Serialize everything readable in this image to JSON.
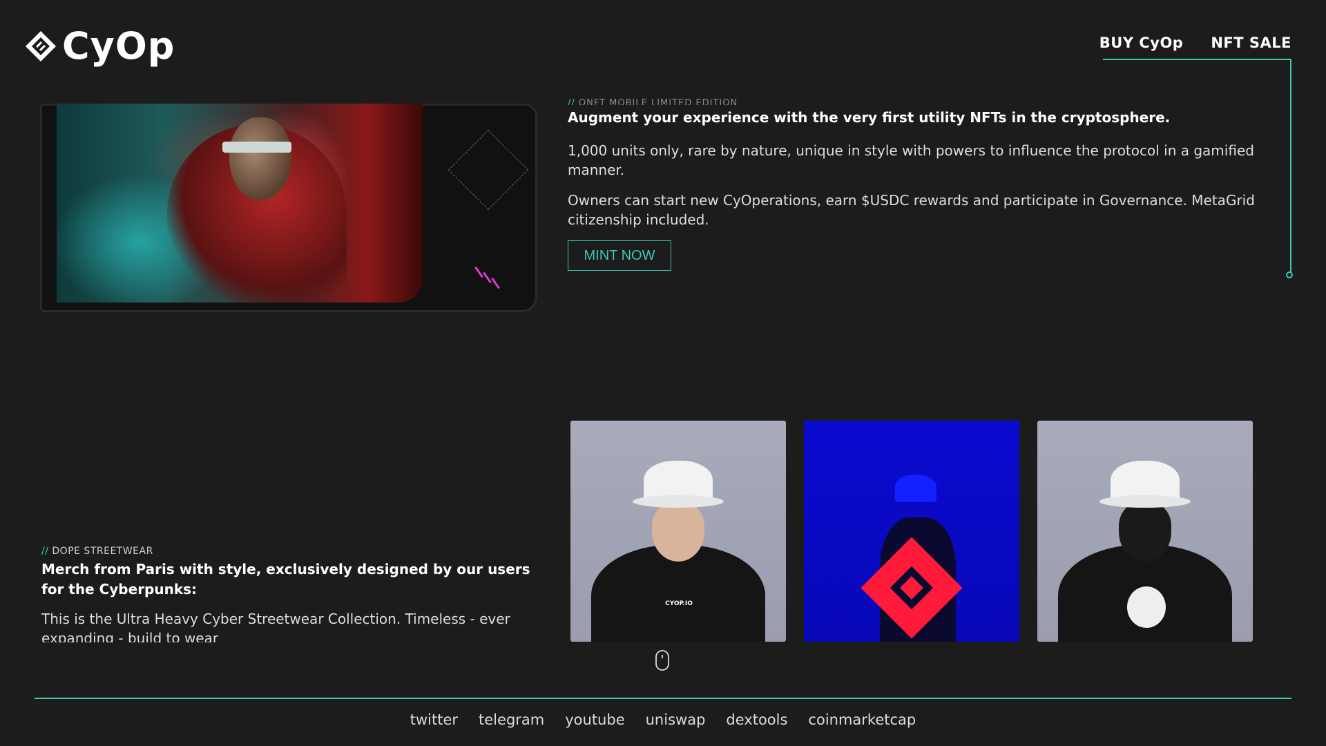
{
  "brand": {
    "name": "CyOp",
    "logo_icon": "cyop-diamond-logo"
  },
  "nav": {
    "items": [
      "BUY CyOp",
      "NFT SALE"
    ]
  },
  "colors": {
    "accent": "#3cc8b4",
    "background": "#1c1c1c",
    "text": "#ffffff"
  },
  "nft_section": {
    "tag": "ONFT MOBILE LIMITED EDITION",
    "headline": "Augment your experience with the very first utility NFTs in the cryptosphere.",
    "paragraph1": "1,000 units only, rare by nature, unique in style with powers to influence the protocol in a gamified manner.",
    "paragraph2": "Owners can start new CyOperations, earn $USDC rewards and participate in Governance. MetaGrid citizenship included.",
    "cta_label": "MINT NOW"
  },
  "street_section": {
    "tag": "DOPE STREETWEAR",
    "headline": "Merch from Paris with style, exclusively designed by our users for the Cyberpunks:",
    "paragraph": "This is the Ultra Heavy Cyber Streetwear Collection. Timeless - ever expanding - build to wear",
    "cards": [
      {
        "alt": "model front in white bucket hat and black CYOP.IO hoodie",
        "print": "CYOP.IO"
      },
      {
        "alt": "model in blue light with red CyOp logo"
      },
      {
        "alt": "model back view with printed hoodie"
      }
    ]
  },
  "scroll_indicator": {
    "icon": "mouse-scroll-icon"
  },
  "footer": {
    "links": [
      "twitter",
      "telegram",
      "youtube",
      "uniswap",
      "dextools",
      "coinmarketcap"
    ]
  }
}
